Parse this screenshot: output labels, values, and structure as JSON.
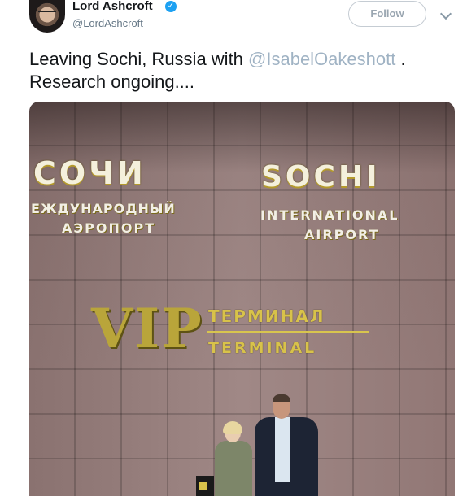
{
  "author": {
    "display_name": "Lord Ashcroft",
    "handle": "@LordAshcroft",
    "verified_icon": "verified-badge-icon"
  },
  "actions": {
    "follow_label": "Follow",
    "more_icon": "chevron-down-icon"
  },
  "tweet": {
    "text_before": "Leaving Sochi, Russia with ",
    "mention": "@IsabelOakeshott",
    "text_after": " . Research ongoing...."
  },
  "photo": {
    "sign_left_big": "СОЧИ",
    "sign_left_line1": "ЕЖДУНАРОДНЫЙ",
    "sign_left_line2": "АЭРОПОРТ",
    "sign_right_big": "SOCHI",
    "sign_right_line1": "INTERNATIONAL",
    "sign_right_line2": "AIRPORT",
    "vip": "VIP",
    "terminal_ru": "ТЕРМИНАЛ",
    "terminal_en": "TERMINAL"
  },
  "colors": {
    "link": "#a0b3c4",
    "verified": "#1da1f2",
    "gold_sign": "#d8c24a"
  }
}
